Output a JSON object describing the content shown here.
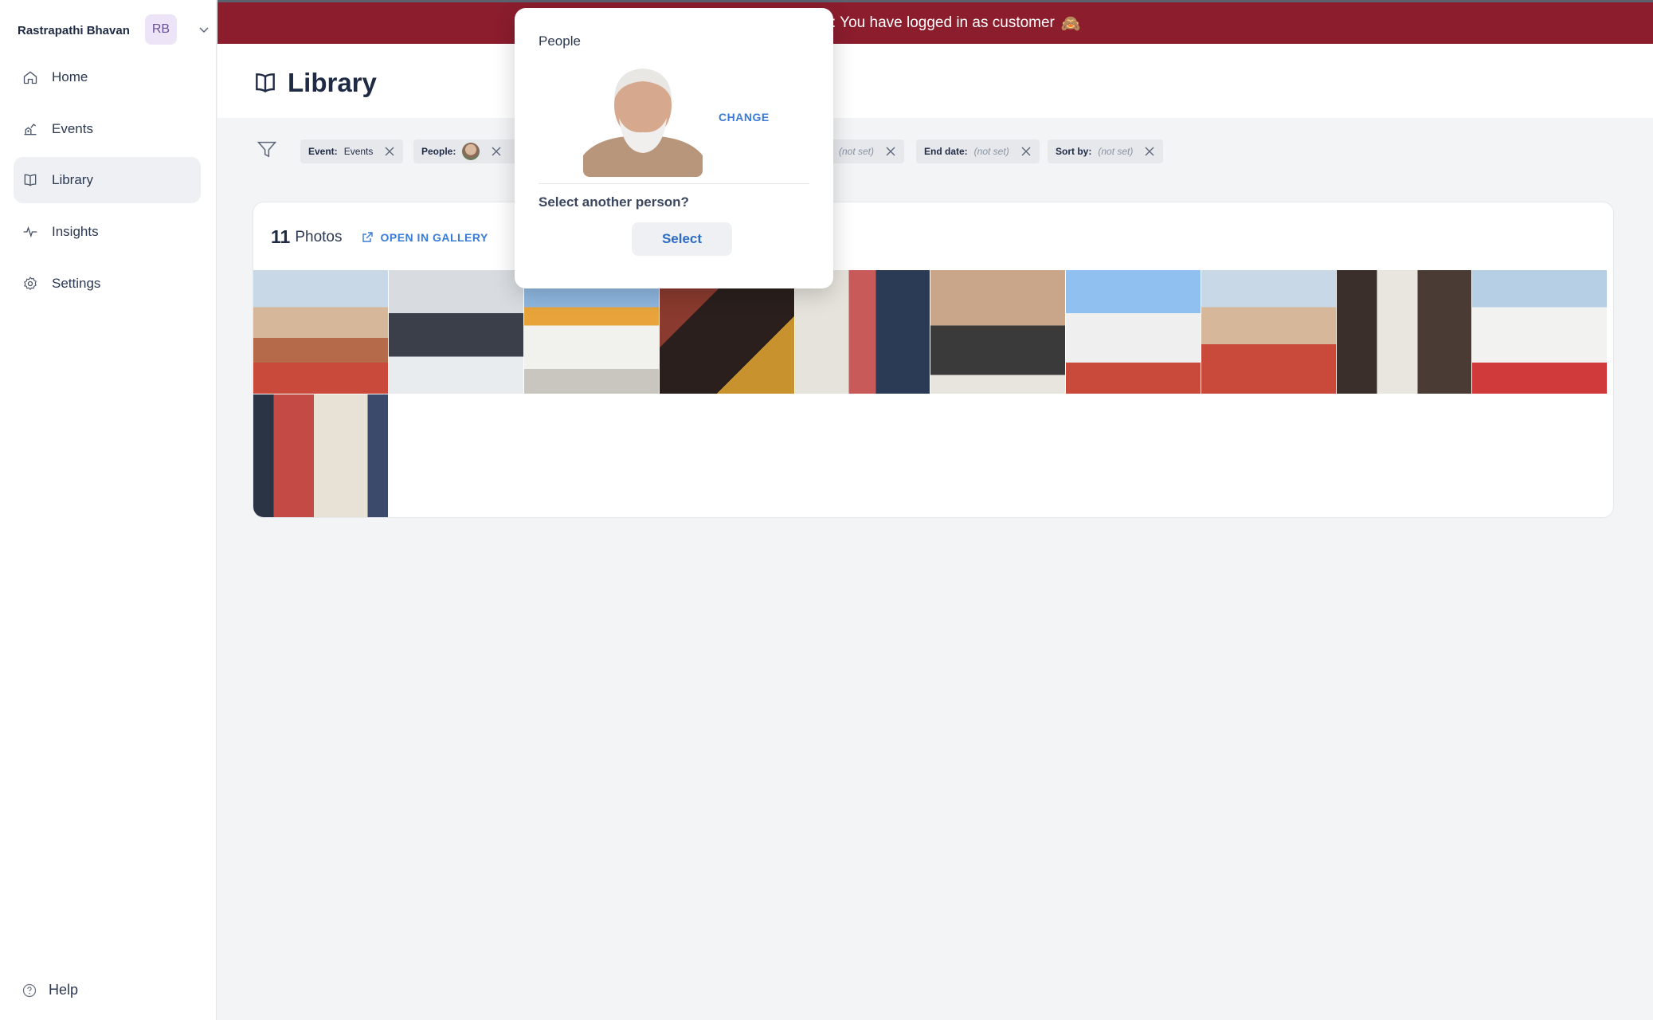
{
  "sidebar": {
    "org_name": "Rastrapathi Bhavan",
    "avatar_initials": "RB",
    "items": [
      {
        "label": "Home",
        "icon": "home-icon"
      },
      {
        "label": "Events",
        "icon": "events-icon"
      },
      {
        "label": "Library",
        "icon": "book-icon",
        "active": true
      },
      {
        "label": "Insights",
        "icon": "activity-icon"
      },
      {
        "label": "Settings",
        "icon": "gear-icon"
      }
    ],
    "help_label": "Help"
  },
  "banner": {
    "text": "NOTE: You have logged in as customer",
    "emoji": "🙈"
  },
  "header": {
    "title": "Library"
  },
  "filters": {
    "chips": [
      {
        "key": "Event:",
        "value": "Events"
      },
      {
        "key": "People:",
        "value": ""
      },
      {
        "key": "",
        "value": "(not set)"
      },
      {
        "key": "End date:",
        "value": "(not set)"
      },
      {
        "key": "Sort by:",
        "value": "(not set)"
      }
    ]
  },
  "photos": {
    "count": "11",
    "label": "Photos",
    "gallery_link": "OPEN IN GALLERY"
  },
  "popover": {
    "title": "People",
    "change_label": "CHANGE",
    "question": "Select another person?",
    "select_label": "Select"
  },
  "colors": {
    "banner": "#8b1d2d",
    "accent_blue": "#3a7bd5",
    "avatar_bg": "#ede4f7",
    "active_nav": "#eef0f3"
  }
}
